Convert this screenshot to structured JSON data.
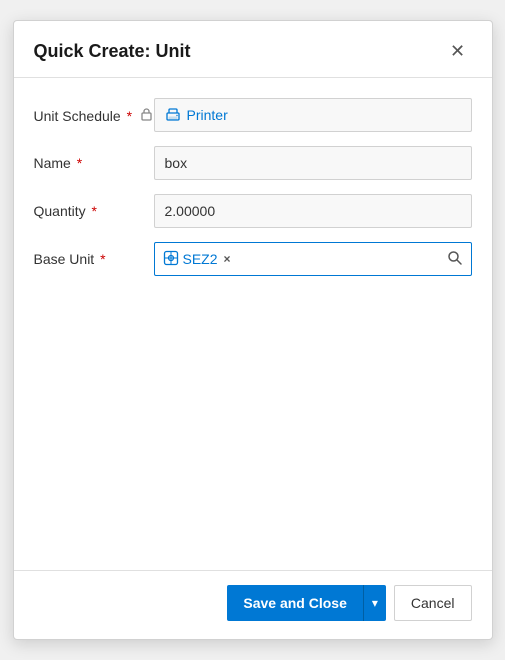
{
  "dialog": {
    "title": "Quick Create: Unit",
    "close_label": "×"
  },
  "form": {
    "unit_schedule": {
      "label": "Unit Schedule",
      "required": true,
      "locked": true,
      "value": "Printer",
      "icon": "printer-icon"
    },
    "name": {
      "label": "Name",
      "required": true,
      "value": "box",
      "placeholder": ""
    },
    "quantity": {
      "label": "Quantity",
      "required": true,
      "value": "2.00000",
      "placeholder": ""
    },
    "base_unit": {
      "label": "Base Unit",
      "required": true,
      "value": "SEZ2",
      "icon": "entity-icon"
    }
  },
  "footer": {
    "save_and_close": "Save and Close",
    "dropdown_aria": "More options",
    "cancel": "Cancel"
  },
  "icons": {
    "close": "✕",
    "lock": "🔒",
    "chevron_down": "▾",
    "search": "🔍",
    "remove": "×"
  }
}
